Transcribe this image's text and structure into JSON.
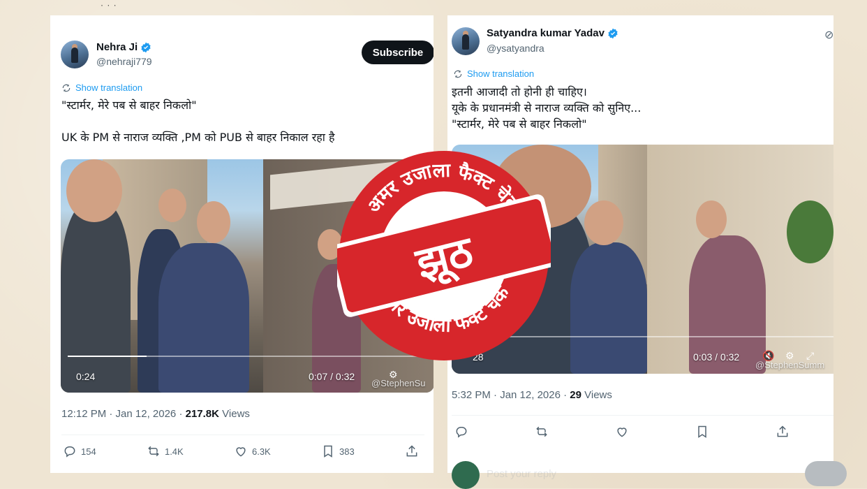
{
  "left_tweet": {
    "display_name": "Nehra Ji",
    "handle": "@nehraji779",
    "subscribe_label": "Subscribe",
    "translate_label": "Show translation",
    "text": "\"स्टार्मर, मेरे पब से बाहर निकलो\"\n\nUK के PM से नाराज व्यक्ति ,PM को PUB से बाहर निकाल रहा है",
    "video": {
      "elapsed": "0:24",
      "time": "0:07 / 0:32",
      "watermark": "@StephenSu",
      "progress": 0.22
    },
    "timestamp": "12:12 PM · Jan 12, 2026 · ",
    "views_count": "217.8K",
    "views_label": "Views",
    "replies": "154",
    "reposts": "1.4K",
    "likes": "6.3K",
    "bookmarks": "383"
  },
  "right_tweet": {
    "display_name": "Satyandra kumar Yadav",
    "handle": "@ysatyandra",
    "translate_label": "Show translation",
    "text": "इतनी आजादी तो होनी ही चाहिए।\nयूके के प्रधानमंत्री से नाराज व्यक्ति को सुनिए...\n \"स्टार्मर, मेरे पब से बाहर निकलो\"",
    "video": {
      "elapsed": "28",
      "time": "0:03 / 0:32",
      "watermark": "@StephenSumm",
      "progress": 0.09
    },
    "timestamp": "5:32 PM · Jan 12, 2026 · ",
    "views_count": "29",
    "views_label": "Views",
    "faded_text": "Post your reply"
  },
  "stamp": {
    "top_text": "अमर उजाला फैक्ट चेक",
    "bottom_text": "अमर उजाला फैक्ट चेक",
    "verdict": "झूठ",
    "color": "#d7262b"
  },
  "colors": {
    "link": "#1d9bf0",
    "muted": "#536471",
    "background": "#efe5d3"
  },
  "icons": [
    "verified-badge-icon",
    "translate-icon",
    "reply-icon",
    "repost-icon",
    "like-icon",
    "bookmark-icon",
    "share-icon",
    "settings-icon",
    "volume-icon",
    "fullscreen-icon"
  ]
}
